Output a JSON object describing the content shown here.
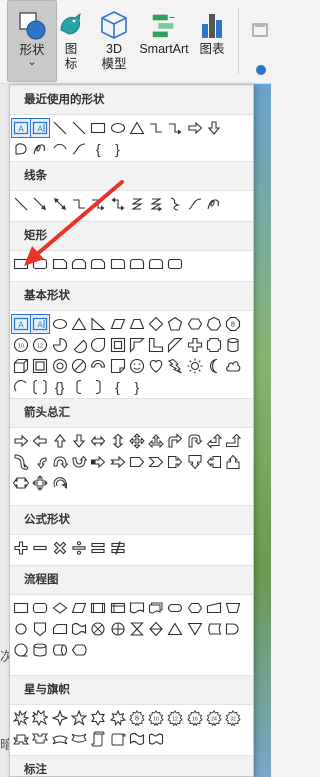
{
  "ribbon": {
    "shapes_label": "形状",
    "shapes_dropdown": "⌄",
    "icons_label": "图\n标",
    "model3d_label": "3D\n模型",
    "smartart_label": "SmartArt",
    "chart_label": "图表"
  },
  "background": {
    "side_text_1": "次",
    "side_text_2": "暗"
  },
  "sections": [
    {
      "key": "recent",
      "title": "最近使用的形状"
    },
    {
      "key": "lines",
      "title": "线条"
    },
    {
      "key": "rect",
      "title": "矩形"
    },
    {
      "key": "basic",
      "title": "基本形状"
    },
    {
      "key": "arrows",
      "title": "箭头总汇"
    },
    {
      "key": "formula",
      "title": "公式形状"
    },
    {
      "key": "flow",
      "title": "流程图"
    },
    {
      "key": "stars",
      "title": "星与旗帜"
    },
    {
      "key": "callouts",
      "title": "标注"
    }
  ],
  "glyph_labels": {
    "lbrace": "{",
    "rbrace": "}",
    "bracket_pair": "{}",
    "numbered_octagon": "8",
    "numbered_decagon": "10",
    "numbered_dodecagon": "12",
    "star_eight": "8",
    "star_ten": "10",
    "star_twelve": "12",
    "star_sixteen": "16",
    "star_twentyfour": "24",
    "star_thirtytwo": "32"
  },
  "colors": {
    "accent": "#2b74d6",
    "annotation_arrow": "#e8332a"
  }
}
